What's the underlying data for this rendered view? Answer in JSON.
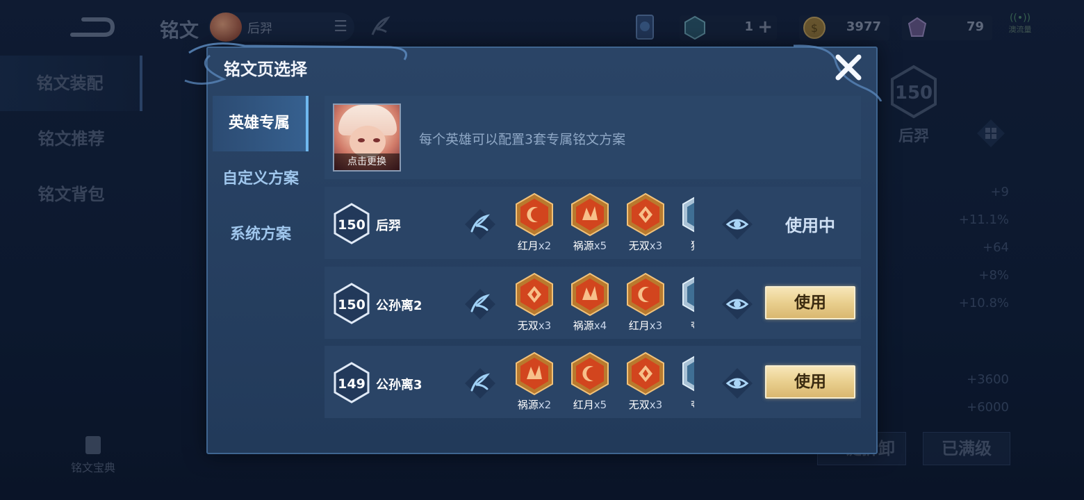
{
  "background": {
    "title": "铭文",
    "hero_name": "后羿",
    "resources": {
      "tickets": "1",
      "gold": "3977",
      "gems": "79"
    },
    "network": "澳流量",
    "side_nav": [
      "铭文装配",
      "铭文推荐",
      "铭文背包"
    ],
    "codex_label": "铭文宝典",
    "right_panel": {
      "level": "150",
      "hero": "后羿",
      "stats": [
        "+9",
        "+11.1%",
        "+64",
        "+8%",
        "+10.8%",
        "+3600",
        "+6000"
      ]
    },
    "buttons": {
      "uninstall": "一键拆卸",
      "maxed": "已满级"
    }
  },
  "dialog": {
    "title": "铭文页选择",
    "tabs": [
      {
        "label": "英雄专属",
        "active": true
      },
      {
        "label": "自定义方案",
        "active": false
      },
      {
        "label": "系统方案",
        "active": false
      }
    ],
    "info": {
      "portrait_caption": "点击更换",
      "text": "每个英雄可以配置3套专属铭文方案"
    },
    "pages": [
      {
        "level": "150",
        "name": "后羿",
        "runes": [
          {
            "name": "红月",
            "count": "x2",
            "color": "red"
          },
          {
            "name": "祸源",
            "count": "x5",
            "color": "red"
          },
          {
            "name": "无双",
            "count": "x3",
            "color": "red"
          },
          {
            "name": "狩猎",
            "count": "",
            "color": "blue"
          }
        ],
        "status": "使用中",
        "in_use": true
      },
      {
        "level": "150",
        "name": "公孙离2",
        "runes": [
          {
            "name": "无双",
            "count": "x3",
            "color": "red"
          },
          {
            "name": "祸源",
            "count": "x4",
            "color": "red"
          },
          {
            "name": "红月",
            "count": "x3",
            "color": "red"
          },
          {
            "name": "夺萃",
            "count": "",
            "color": "blue"
          }
        ],
        "status": "使用",
        "in_use": false
      },
      {
        "level": "149",
        "name": "公孙离3",
        "runes": [
          {
            "name": "祸源",
            "count": "x2",
            "color": "red"
          },
          {
            "name": "红月",
            "count": "x5",
            "color": "red"
          },
          {
            "name": "无双",
            "count": "x3",
            "color": "red"
          },
          {
            "name": "夺萃",
            "count": "",
            "color": "blue"
          }
        ],
        "status": "使用",
        "in_use": false
      }
    ]
  },
  "colors": {
    "accent_gold": "#e9cf8e",
    "rune_red": "#d2451e",
    "panel_blue": "#2a4466",
    "active_tab_line": "#6fb7ee"
  }
}
